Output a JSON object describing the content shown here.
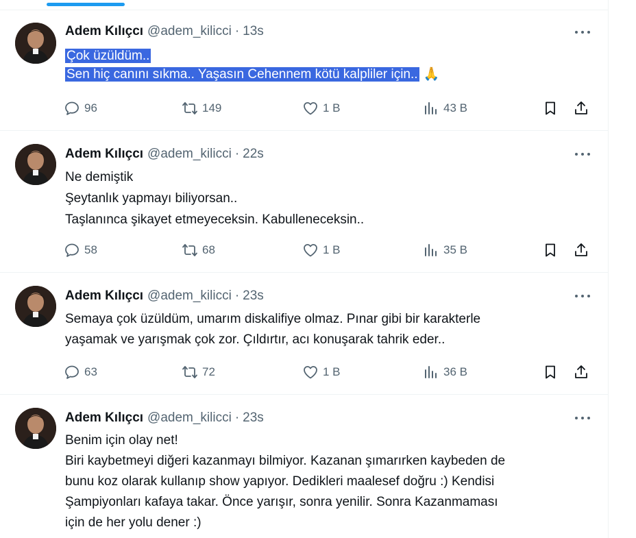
{
  "tweets": [
    {
      "name": "Adem Kılıçcı",
      "handle": "@adem_kilicci",
      "time": "13s",
      "lines": [
        "Çok üzüldüm..",
        "Sen hiç canını sıkma.. Yaşasın Cehennem kötü kalpliler için.."
      ],
      "emoji": "🙏",
      "replies": "96",
      "retweets": "149",
      "likes": "1 B",
      "views": "43 B"
    },
    {
      "name": "Adem Kılıçcı",
      "handle": "@adem_kilicci",
      "time": "22s",
      "lines": [
        "Ne demiştik",
        "Şeytanlık yapmayı biliyorsan..",
        "Taşlanınca şikayet etmeyeceksin. Kabulleneceksin.."
      ],
      "replies": "58",
      "retweets": "68",
      "likes": "1 B",
      "views": "35 B"
    },
    {
      "name": "Adem Kılıçcı",
      "handle": "@adem_kilicci",
      "time": "23s",
      "lines": [
        "Semaya çok üzüldüm, umarım diskalifiye olmaz. Pınar gibi bir karakterle",
        "yaşamak ve yarışmak çok zor. Çıldırtır, acı konuşarak tahrik eder.."
      ],
      "replies": "63",
      "retweets": "72",
      "likes": "1 B",
      "views": "36 B"
    },
    {
      "name": "Adem Kılıçcı",
      "handle": "@adem_kilicci",
      "time": "23s",
      "lines": [
        "Benim için olay net!",
        "Biri kaybetmeyi diğeri kazanmayı bilmiyor. Kazanan şımarırken kaybeden de",
        "bunu koz olarak kullanıp show yapıyor. Dedikleri maalesef doğru :) Kendisi",
        "Şampiyonları kafaya takar. Önce yarışır, sonra yenilir. Sonra Kazanmaması",
        "için de her yolu dener :)"
      ]
    }
  ],
  "colors": {
    "accent": "#1d9bf0",
    "highlight": "#3a68e0",
    "secondary_text": "#536471",
    "divider": "#eff3f4"
  },
  "icons": {
    "reply": "speech-bubble-icon",
    "retweet": "retweet-arrows-icon",
    "like": "heart-icon",
    "views": "bar-chart-icon",
    "bookmark": "bookmark-icon",
    "share": "share-upload-icon",
    "more": "three-dots-icon"
  }
}
